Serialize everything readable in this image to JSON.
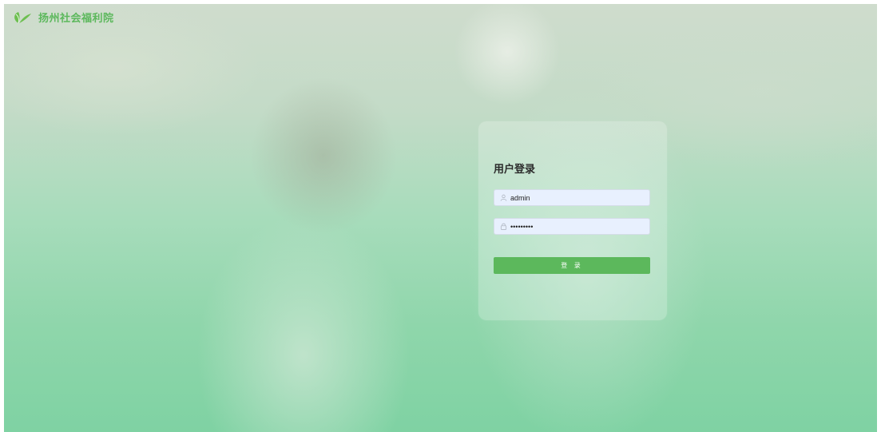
{
  "header": {
    "logo_icon": "leaf-logo-icon",
    "title": "扬州社会福利院"
  },
  "login": {
    "title": "用户登录",
    "username": {
      "icon": "user-icon",
      "value": "admin"
    },
    "password": {
      "icon": "lock-icon",
      "value": "•••••••••"
    },
    "submit_label": "登 录"
  },
  "colors": {
    "brand_green": "#5cb85c",
    "input_bg": "#e8f0fe"
  }
}
